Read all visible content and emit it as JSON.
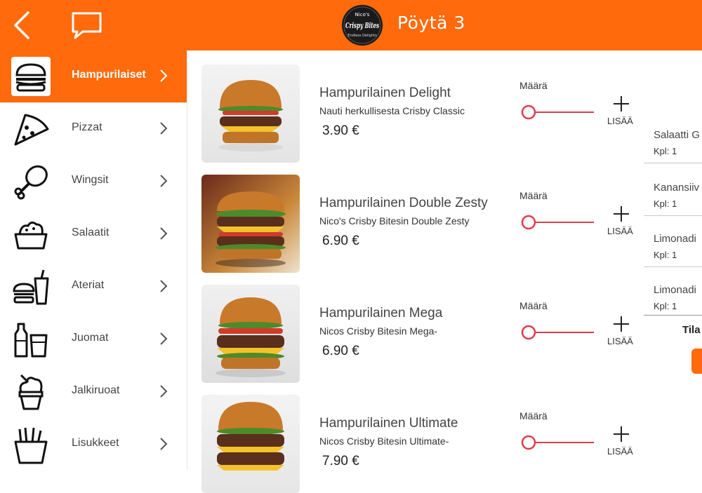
{
  "header": {
    "title": "Pöytä 3",
    "back_icon": "back-chevron-icon",
    "chat_icon": "chat-bubble-icon",
    "logo_top": "Nico's",
    "logo_main": "Crispy Bites",
    "logo_tag": "Endless Delights"
  },
  "sidebar": {
    "items": [
      {
        "label": "Hampurilaiset",
        "icon": "burger-icon",
        "active": true
      },
      {
        "label": "Pizzat",
        "icon": "pizza-icon"
      },
      {
        "label": "Wingsit",
        "icon": "chicken-leg-icon"
      },
      {
        "label": "Salaatit",
        "icon": "salad-bowl-icon"
      },
      {
        "label": "Ateriat",
        "icon": "meal-icon"
      },
      {
        "label": "Juomat",
        "icon": "drinks-icon"
      },
      {
        "label": "Jalkiruoat",
        "icon": "ice-cream-icon"
      },
      {
        "label": "Lisukkeet",
        "icon": "fries-icon"
      }
    ]
  },
  "menu": {
    "quantity_label": "Määrä",
    "add_label": "LISÄÄ",
    "items": [
      {
        "name": "Hampurilainen Delight",
        "description": "Nauti herkullisesta Crisby Classic",
        "price": "3.90 €",
        "quantity": 0
      },
      {
        "name": "Hampurilainen Double Zesty",
        "description": "Nico's Crisby Bitesin Double Zesty",
        "price": "6.90 €",
        "quantity": 0
      },
      {
        "name": "Hampurilainen Mega",
        "description": "Nicos Crisby Bitesin Mega-",
        "price": "6.90 €",
        "quantity": 0
      },
      {
        "name": "Hampurilainen Ultimate",
        "description": "Nicos Crisby Bitesin Ultimate-",
        "price": "7.90 €",
        "quantity": 0
      }
    ]
  },
  "order": {
    "items": [
      {
        "name": "Salaatti G",
        "qty": "Kpl: 1"
      },
      {
        "name": "Kanansiiv",
        "qty": "Kpl: 1"
      },
      {
        "name": "Limonadi",
        "qty": "Kpl: 1"
      },
      {
        "name": "Limonadi",
        "qty": "Kpl: 1"
      }
    ],
    "submit_label": "Tila"
  },
  "colors": {
    "accent": "#ff6a0c",
    "slider": "#e03c4a"
  }
}
